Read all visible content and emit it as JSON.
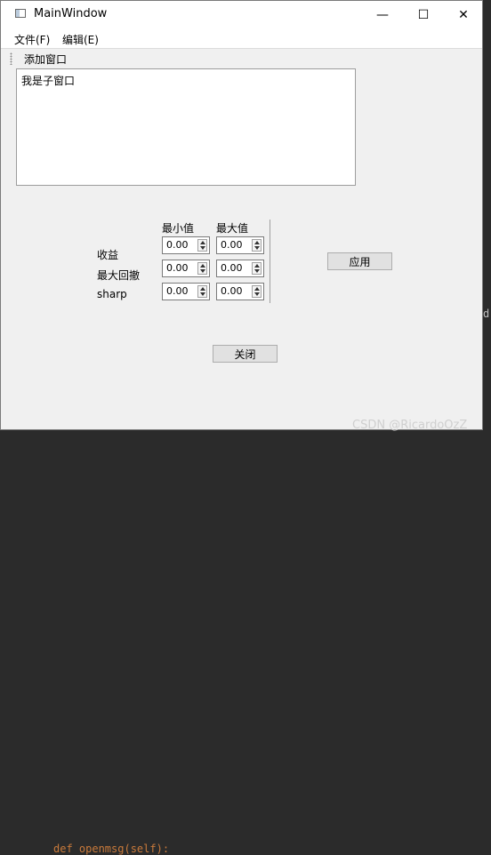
{
  "window": {
    "title": "MainWindow",
    "controls": {
      "minimize": "—",
      "maximize": "☐",
      "close": "✕"
    }
  },
  "menu": {
    "items": [
      "文件(F)",
      "编辑(E)"
    ]
  },
  "toolbar": {
    "add_window": "添加窗口"
  },
  "subwindow": {
    "text": "我是子窗口"
  },
  "form": {
    "headers": {
      "min": "最小值",
      "max": "最大值"
    },
    "rows": [
      {
        "label": "收益",
        "min": "0.00",
        "max": "0.00"
      },
      {
        "label": "最大回撤",
        "min": "0.00",
        "max": "0.00"
      },
      {
        "label": "sharp",
        "min": "0.00",
        "max": "0.00"
      }
    ],
    "apply_label": "应用",
    "close_label": "关闭"
  },
  "background": {
    "code_text": "def openmsg(self):",
    "right_char": "d",
    "watermark": "CSDN @RicardoOzZ"
  }
}
